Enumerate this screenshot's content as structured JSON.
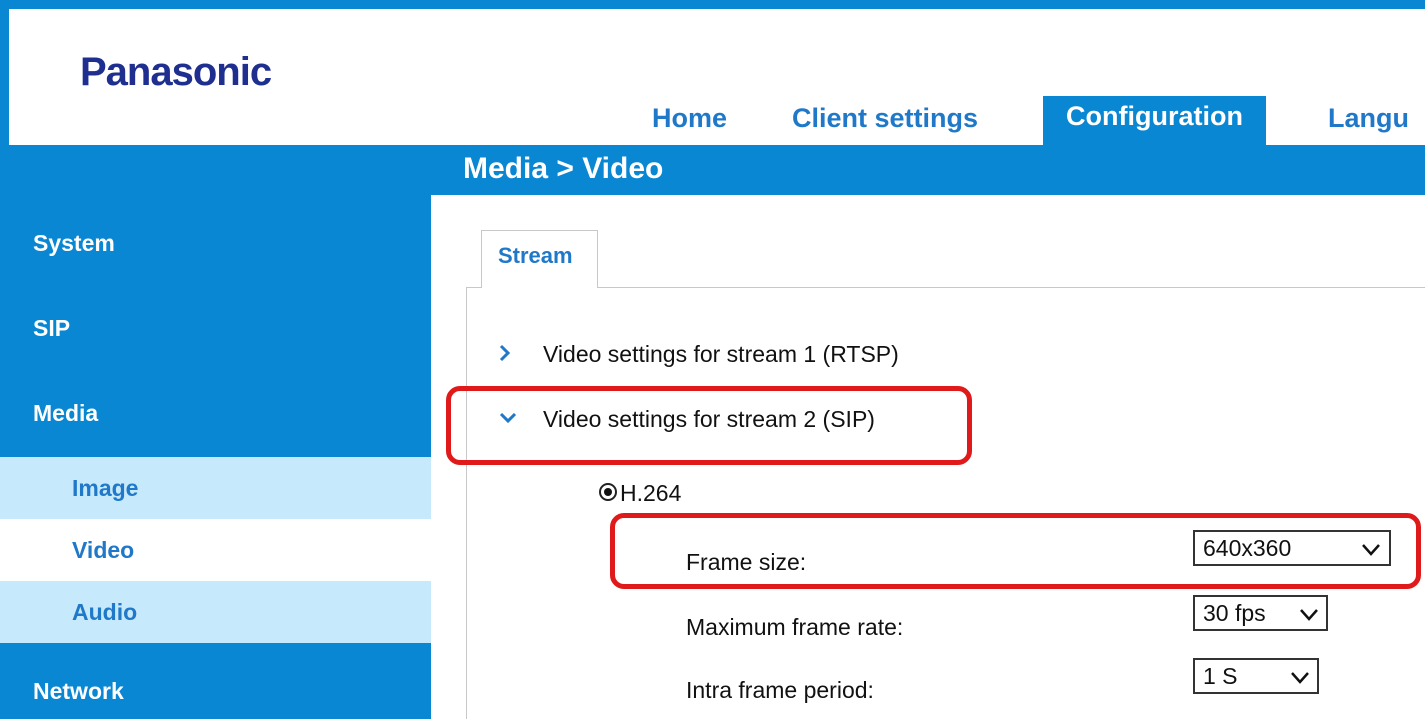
{
  "brand": {
    "logo": "Panasonic"
  },
  "nav": {
    "items": [
      {
        "label": "Home",
        "active": false
      },
      {
        "label": "Client settings",
        "active": false
      },
      {
        "label": "Configuration",
        "active": true
      },
      {
        "label": "Langu",
        "active": false
      }
    ]
  },
  "breadcrumb": "Media  > Video",
  "sidebar": {
    "system": "System",
    "sip": "SIP",
    "media": "Media",
    "media_sub": [
      "Image",
      "Video",
      "Audio"
    ],
    "network": "Network"
  },
  "tabs": {
    "stream": "Stream"
  },
  "sections": {
    "stream1": "Video settings for stream 1 (RTSP)",
    "stream2": "Video settings for stream 2 (SIP)"
  },
  "codec": {
    "label": "H.264",
    "selected": true
  },
  "fields": {
    "frame_size": {
      "label": "Frame size:",
      "value": "640x360"
    },
    "max_frame_rate": {
      "label": "Maximum frame rate:",
      "value": "30 fps"
    },
    "intra_frame_period": {
      "label": "Intra frame period:",
      "value": "1 S"
    }
  },
  "colors": {
    "brand_blue": "#0a87d2",
    "logo": "#1f2f8f",
    "highlight": "#e01a1a",
    "submenu": "#c6e9fb"
  }
}
